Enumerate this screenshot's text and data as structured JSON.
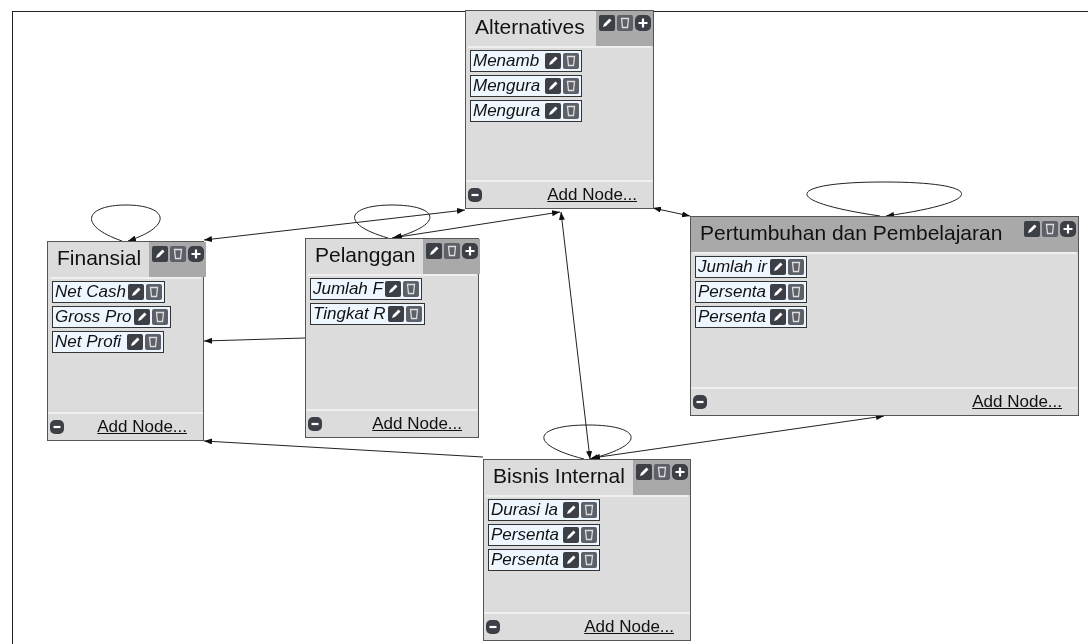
{
  "nodes": [
    {
      "title": "Alternatives",
      "selected": false,
      "items": [
        "Menamb",
        "Mengura",
        "Mengura"
      ],
      "add_label": "Add Node..."
    },
    {
      "title": "Finansial",
      "selected": false,
      "items": [
        "Net Cash",
        "Gross Pro",
        "Net Profi"
      ],
      "add_label": "Add Node..."
    },
    {
      "title": "Pelanggan",
      "selected": false,
      "items": [
        "Jumlah F",
        "Tingkat R"
      ],
      "add_label": "Add Node..."
    },
    {
      "title": "Pertumbuhan dan Pembelajaran",
      "selected": true,
      "items": [
        "Jumlah ir",
        "Persenta",
        "Persenta"
      ],
      "add_label": "Add Node..."
    },
    {
      "title": "Bisnis Internal",
      "selected": false,
      "items": [
        "Durasi la",
        "Persenta",
        "Persenta"
      ],
      "add_label": "Add Node..."
    }
  ]
}
